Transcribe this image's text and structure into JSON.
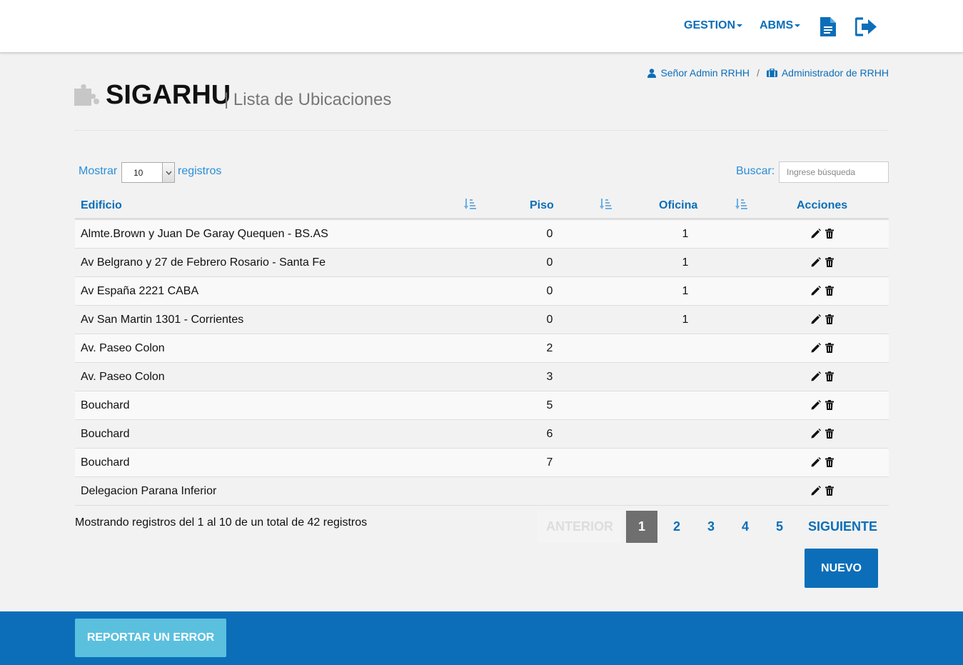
{
  "navbar": {
    "gestion_label": "GESTION",
    "abms_label": "ABMS",
    "doc_icon": "document-icon",
    "logout_icon": "logout-icon"
  },
  "breadcrumb": {
    "user": "Señor Admin RRHH",
    "separator": "/",
    "role": "Administrador de RRHH"
  },
  "header": {
    "app_title": "SIGARHU",
    "subtitle": "| Lista de Ubicaciones",
    "icon": "puzzle-icon"
  },
  "controls": {
    "show_label": "Mostrar",
    "page_size": "10",
    "records_label": "registros",
    "search_label": "Buscar:",
    "search_placeholder": "Ingrese búsqueda"
  },
  "table": {
    "columns": [
      "Edificio",
      "Piso",
      "Oficina",
      "Acciones"
    ],
    "rows": [
      {
        "edificio": "Almte.Brown y Juan De Garay Quequen - BS.AS",
        "piso": "0",
        "oficina": "1"
      },
      {
        "edificio": "Av Belgrano y 27 de Febrero Rosario - Santa Fe",
        "piso": "0",
        "oficina": "1"
      },
      {
        "edificio": "Av España 2221 CABA",
        "piso": "0",
        "oficina": "1"
      },
      {
        "edificio": "Av San Martin 1301 - Corrientes",
        "piso": "0",
        "oficina": "1"
      },
      {
        "edificio": "Av. Paseo Colon",
        "piso": "2",
        "oficina": ""
      },
      {
        "edificio": "Av. Paseo Colon",
        "piso": "3",
        "oficina": ""
      },
      {
        "edificio": "Bouchard",
        "piso": "5",
        "oficina": ""
      },
      {
        "edificio": "Bouchard",
        "piso": "6",
        "oficina": ""
      },
      {
        "edificio": "Bouchard",
        "piso": "7",
        "oficina": ""
      },
      {
        "edificio": "Delegacion Parana Inferior",
        "piso": "",
        "oficina": ""
      }
    ]
  },
  "info": "Mostrando registros del 1 al 10 de un total de 42 registros",
  "pagination": {
    "prev": "ANTERIOR",
    "pages": [
      "1",
      "2",
      "3",
      "4",
      "5"
    ],
    "active_page": "1",
    "next": "SIGUIENTE"
  },
  "buttons": {
    "new": "NUEVO",
    "report": "REPORTAR UN ERROR"
  },
  "colors": {
    "primary": "#0c6eb8",
    "link": "#2a8ed8",
    "report_button": "#5bc0de",
    "active_page": "#6f6f6f"
  }
}
